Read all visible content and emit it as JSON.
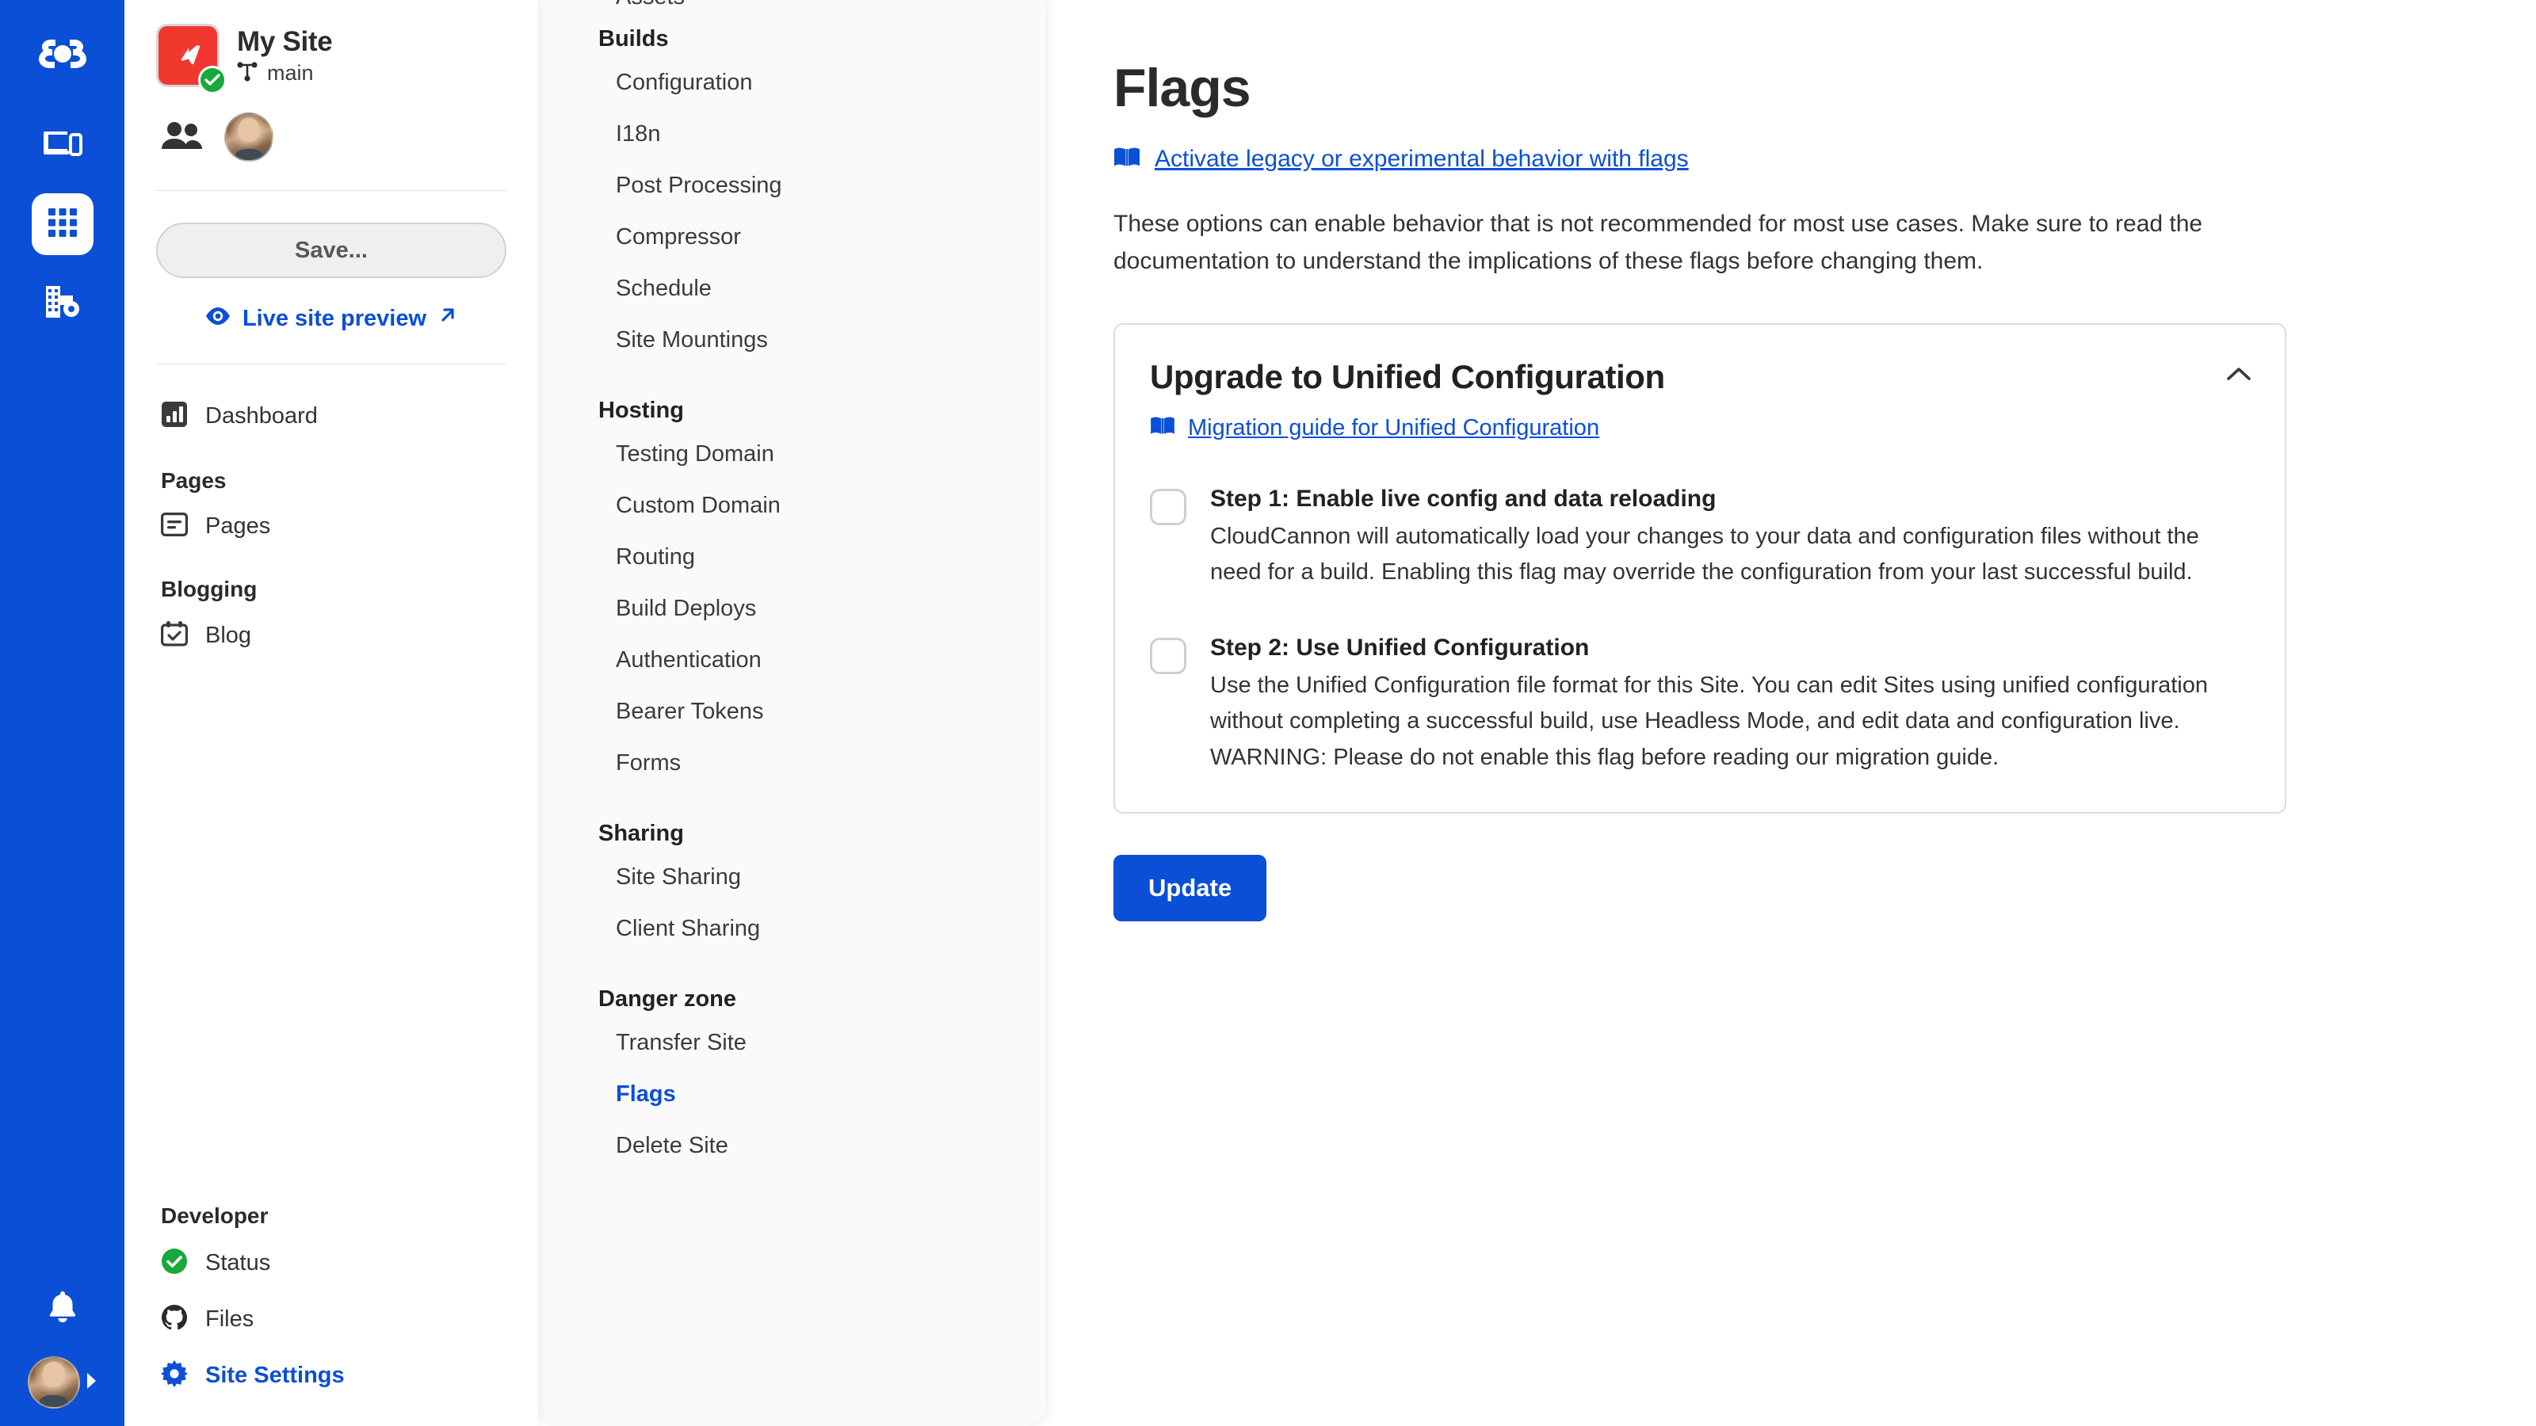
{
  "rail": {
    "logo_icon": "cloudcannon-logo-icon",
    "items": [
      {
        "icon": "devices-icon",
        "name": "devices",
        "active": false
      },
      {
        "icon": "apps-grid-icon",
        "name": "apps",
        "active": true
      },
      {
        "icon": "organisation-settings-icon",
        "name": "organisation-settings",
        "active": false
      }
    ],
    "bell_icon": "bell-icon",
    "avatar_label": "user-avatar",
    "caret_icon": "caret-right-icon"
  },
  "site": {
    "name": "My Site",
    "branch": "main",
    "branch_icon": "branch-icon",
    "status_icon": "check-circle-icon",
    "logo_icon": "site-cursor-icon",
    "collaborators_icon": "people-icon"
  },
  "actions": {
    "save_label": "Save...",
    "live_preview_label": "Live site preview",
    "eye_icon": "eye-icon",
    "external_icon": "external-link-arrow-icon"
  },
  "nav": {
    "dashboard": {
      "label": "Dashboard",
      "icon": "dashboard-icon"
    },
    "groups": [
      {
        "title": "Pages",
        "items": [
          {
            "label": "Pages",
            "icon": "pages-icon"
          }
        ]
      },
      {
        "title": "Blogging",
        "items": [
          {
            "label": "Blog",
            "icon": "calendar-check-icon"
          }
        ]
      }
    ],
    "developer": {
      "title": "Developer",
      "items": [
        {
          "label": "Status",
          "icon": "status-ok-icon",
          "current": false
        },
        {
          "label": "Files",
          "icon": "github-icon",
          "current": false
        },
        {
          "label": "Site Settings",
          "icon": "gear-icon",
          "current": true
        }
      ]
    }
  },
  "settings_nav": {
    "cut_off_item": "Assets",
    "groups": [
      {
        "title": "Builds",
        "items": [
          "Configuration",
          "I18n",
          "Post Processing",
          "Compressor",
          "Schedule",
          "Site Mountings"
        ]
      },
      {
        "title": "Hosting",
        "items": [
          "Testing Domain",
          "Custom Domain",
          "Routing",
          "Build Deploys",
          "Authentication",
          "Bearer Tokens",
          "Forms"
        ]
      },
      {
        "title": "Sharing",
        "items": [
          "Site Sharing",
          "Client Sharing"
        ]
      },
      {
        "title": "Danger zone",
        "items": [
          "Transfer Site",
          "Flags",
          "Delete Site"
        ],
        "active": "Flags"
      }
    ]
  },
  "main": {
    "title": "Flags",
    "doc_link": "Activate legacy or experimental behavior with flags",
    "doc_icon": "book-icon",
    "intro": "These options can enable behavior that is not recommended for most use cases. Make sure to read the documentation to understand the implications of these flags before changing them.",
    "card": {
      "title": "Upgrade to Unified Configuration",
      "link": "Migration guide for Unified Configuration",
      "link_icon": "book-icon",
      "collapse_icon": "chevron-up-icon",
      "steps": [
        {
          "title": "Step 1: Enable live config and data reloading",
          "description": "CloudCannon will automatically load your changes to your data and configuration files without the need for a build. Enabling this flag may override the configuration from your last successful build.",
          "checked": false
        },
        {
          "title": "Step 2: Use Unified Configuration",
          "description": "Use the Unified Configuration file format for this Site. You can edit Sites using unified configuration without completing a successful build, use Headless Mode, and edit data and configuration live. WARNING: Please do not enable this flag before reading our migration guide.",
          "checked": false
        }
      ]
    },
    "update_label": "Update"
  },
  "colors": {
    "brand_blue": "#0B4FD6",
    "site_logo_red": "#F0382F",
    "status_green": "#17A93A",
    "text_dark": "#2b2b2b",
    "panel_bg": "#fafafa"
  }
}
